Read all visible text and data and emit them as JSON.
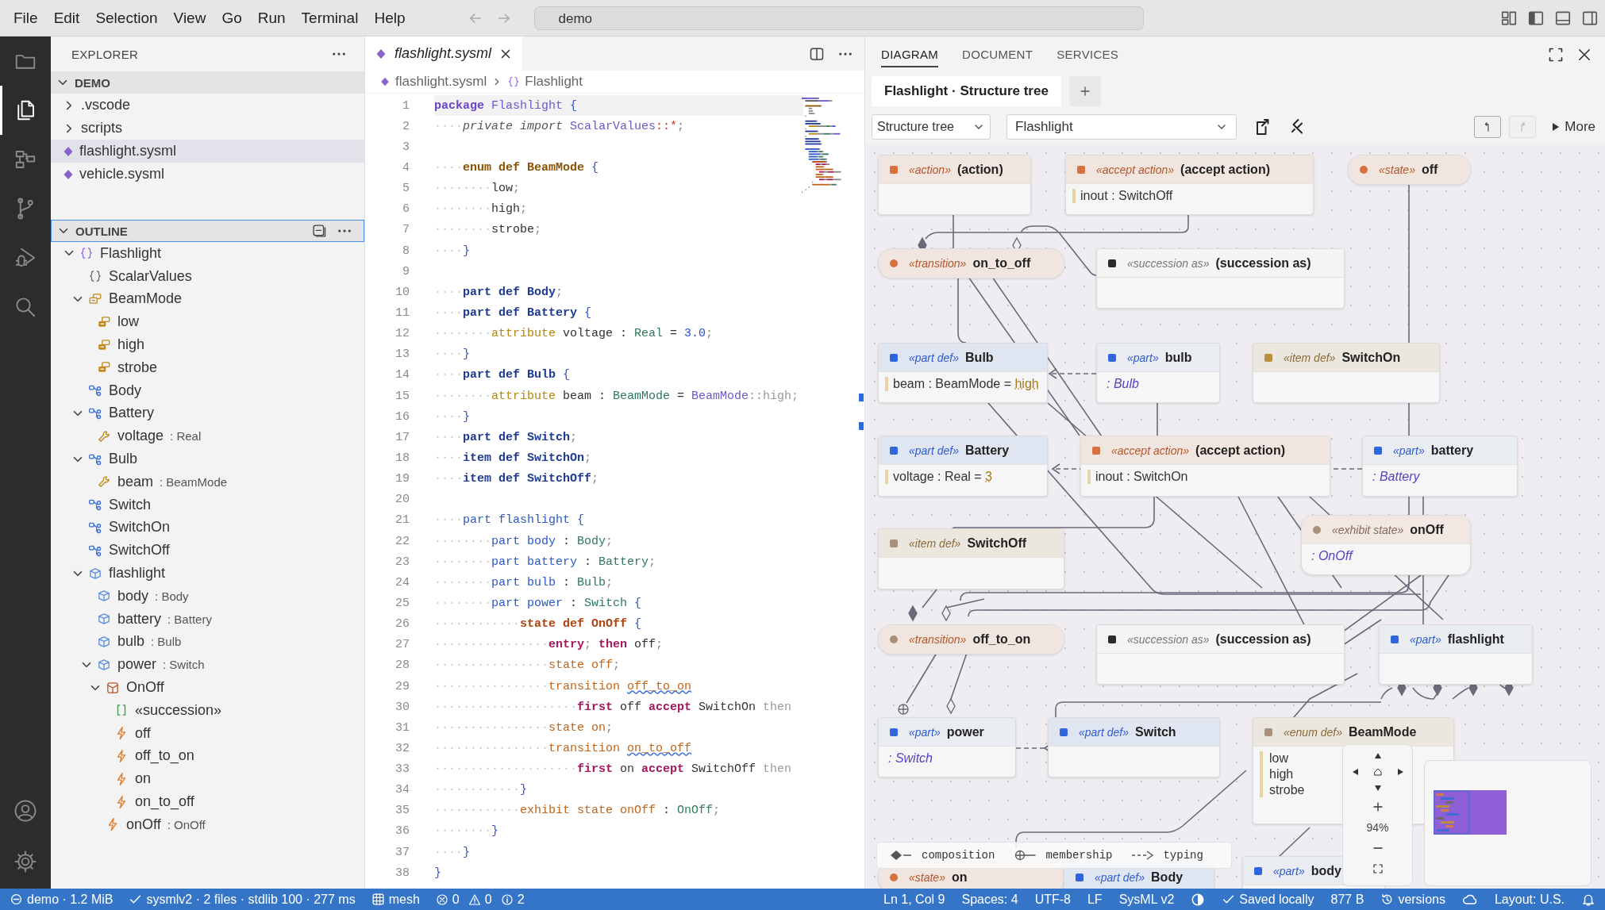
{
  "menu": [
    "File",
    "Edit",
    "Selection",
    "View",
    "Go",
    "Run",
    "Terminal",
    "Help"
  ],
  "command_center": {
    "value": "demo"
  },
  "activity_bar": [
    {
      "selected": false
    },
    {
      "selected": true
    },
    {
      "selected": false
    },
    {
      "selected": false
    },
    {
      "selected": false
    },
    {
      "selected": false
    },
    {
      "selected": false
    },
    {
      "selected": false
    }
  ],
  "sidebar": {
    "title": "EXPLORER",
    "explorer": {
      "title": "DEMO",
      "expanded": true,
      "items": [
        {
          "kind": "folder",
          "label": ".vscode",
          "expanded": false,
          "selected": false
        },
        {
          "kind": "folder",
          "label": "scripts",
          "expanded": false,
          "selected": false
        },
        {
          "kind": "file",
          "label": "flashlight.sysml",
          "selected": true
        },
        {
          "kind": "file",
          "label": "vehicle.sysml",
          "selected": false
        }
      ]
    },
    "outline": {
      "title": "OUTLINE",
      "expanded": true,
      "focused": true,
      "items": [
        {
          "kind": "package",
          "label": "Flashlight",
          "expanded": true,
          "children": [
            {
              "kind": "import",
              "label": "ScalarValues"
            },
            {
              "kind": "enum",
              "label": "BeamMode",
              "expanded": true,
              "children": [
                {
                  "kind": "literal",
                  "label": "low"
                },
                {
                  "kind": "literal",
                  "label": "high"
                },
                {
                  "kind": "literal",
                  "label": "strobe"
                }
              ]
            },
            {
              "kind": "part_def",
              "label": "Body"
            },
            {
              "kind": "part_def",
              "label": "Battery",
              "expanded": true,
              "children": [
                {
                  "kind": "attribute",
                  "label": "voltage",
                  "detail": ": Real"
                }
              ]
            },
            {
              "kind": "part_def",
              "label": "Bulb",
              "expanded": true,
              "children": [
                {
                  "kind": "attribute",
                  "label": "beam",
                  "detail": ": BeamMode"
                }
              ]
            },
            {
              "kind": "part_def",
              "label": "Switch"
            },
            {
              "kind": "part_def",
              "label": "SwitchOn"
            },
            {
              "kind": "part_def",
              "label": "SwitchOff"
            },
            {
              "kind": "part",
              "label": "flashlight",
              "expanded": true,
              "children": [
                {
                  "kind": "part",
                  "label": "body",
                  "detail": ": Body"
                },
                {
                  "kind": "part",
                  "label": "battery",
                  "detail": ": Battery"
                },
                {
                  "kind": "part",
                  "label": "bulb",
                  "detail": ": Bulb"
                },
                {
                  "kind": "part",
                  "label": "power",
                  "detail": ": Switch",
                  "expanded": true,
                  "children": [
                    {
                      "kind": "state_def",
                      "label": "OnOff",
                      "expanded": true,
                      "children": [
                        {
                          "kind": "succession",
                          "label": "«succession»"
                        },
                        {
                          "kind": "state",
                          "label": "off"
                        },
                        {
                          "kind": "state",
                          "label": "off_to_on"
                        },
                        {
                          "kind": "state",
                          "label": "on"
                        },
                        {
                          "kind": "state",
                          "label": "on_to_off"
                        }
                      ]
                    },
                    {
                      "kind": "state",
                      "label": "onOff",
                      "detail": ": OnOff"
                    }
                  ]
                }
              ]
            }
          ]
        }
      ]
    }
  },
  "editor": {
    "tab": {
      "label": "flashlight.sysml",
      "selected": true,
      "preview": true
    },
    "breadcrumb": [
      "flashlight.sysml",
      "Flashlight"
    ],
    "lines": [
      {
        "number": "1",
        "current": true,
        "tokens": [
          {
            "text": "package",
            "kind": "pk"
          },
          {
            "text": " Flashlight ",
            "kind": "id"
          },
          {
            "text": "{",
            "kind": "br"
          }
        ]
      },
      {
        "number": "2",
        "current": false,
        "tokens": [
          {
            "text": "····",
            "kind": "ws"
          },
          {
            "text": "private import ",
            "kind": "it"
          },
          {
            "text": "ScalarValues",
            "kind": "id"
          },
          {
            "text": "::*",
            "kind": "op"
          },
          {
            "text": ";",
            "kind": "pu"
          }
        ]
      },
      {
        "number": "3",
        "current": false
      },
      {
        "number": "4",
        "current": false,
        "tokens": [
          {
            "text": "····",
            "kind": "ws"
          },
          {
            "text": "enum def BeamMode ",
            "kind": "ke"
          },
          {
            "text": "{",
            "kind": "br"
          }
        ]
      },
      {
        "number": "5",
        "current": false,
        "tokens": [
          {
            "text": "········",
            "kind": "ws"
          },
          {
            "text": "low",
            "kind": "pl"
          },
          {
            "text": ";",
            "kind": "pu"
          }
        ]
      },
      {
        "number": "6",
        "current": false,
        "tokens": [
          {
            "text": "········",
            "kind": "ws"
          },
          {
            "text": "high",
            "kind": "pl"
          },
          {
            "text": ";",
            "kind": "pu"
          }
        ]
      },
      {
        "number": "7",
        "current": false,
        "tokens": [
          {
            "text": "········",
            "kind": "ws"
          },
          {
            "text": "strobe",
            "kind": "pl"
          },
          {
            "text": ";",
            "kind": "pu"
          }
        ]
      },
      {
        "number": "8",
        "current": false,
        "tokens": [
          {
            "text": "····",
            "kind": "ws"
          },
          {
            "text": "}",
            "kind": "br"
          }
        ]
      },
      {
        "number": "9",
        "current": false
      },
      {
        "number": "10",
        "current": false,
        "tokens": [
          {
            "text": "····",
            "kind": "ws"
          },
          {
            "text": "part def Body",
            "kind": "kd"
          },
          {
            "text": ";",
            "kind": "pu"
          }
        ]
      },
      {
        "number": "11",
        "current": false,
        "tokens": [
          {
            "text": "····",
            "kind": "ws"
          },
          {
            "text": "part def Battery ",
            "kind": "kd"
          },
          {
            "text": "{",
            "kind": "br"
          }
        ]
      },
      {
        "number": "12",
        "current": false,
        "tokens": [
          {
            "text": "········",
            "kind": "ws"
          },
          {
            "text": "attribute ",
            "kind": "at"
          },
          {
            "text": "voltage : ",
            "kind": "pl"
          },
          {
            "text": "Real",
            "kind": "ty"
          },
          {
            "text": " = ",
            "kind": "pl"
          },
          {
            "text": "3.0",
            "kind": "nu"
          },
          {
            "text": ";",
            "kind": "pu"
          }
        ]
      },
      {
        "number": "13",
        "current": false,
        "tokens": [
          {
            "text": "····",
            "kind": "ws"
          },
          {
            "text": "}",
            "kind": "br"
          }
        ]
      },
      {
        "number": "14",
        "current": false,
        "tokens": [
          {
            "text": "····",
            "kind": "ws"
          },
          {
            "text": "part def Bulb ",
            "kind": "kd"
          },
          {
            "text": "{",
            "kind": "br"
          }
        ]
      },
      {
        "number": "15",
        "current": false,
        "tokens": [
          {
            "text": "········",
            "kind": "ws"
          },
          {
            "text": "attribute ",
            "kind": "at"
          },
          {
            "text": "beam : ",
            "kind": "pl"
          },
          {
            "text": "BeamMode",
            "kind": "ty"
          },
          {
            "text": " = ",
            "kind": "pl"
          },
          {
            "text": "BeamMode",
            "kind": "id"
          },
          {
            "text": "::high;",
            "kind": "gh"
          }
        ]
      },
      {
        "number": "16",
        "current": false,
        "tokens": [
          {
            "text": "····",
            "kind": "ws"
          },
          {
            "text": "}",
            "kind": "br"
          }
        ]
      },
      {
        "number": "17",
        "current": false,
        "tokens": [
          {
            "text": "····",
            "kind": "ws"
          },
          {
            "text": "part def Switch",
            "kind": "kd"
          },
          {
            "text": ";",
            "kind": "pu"
          }
        ]
      },
      {
        "number": "18",
        "current": false,
        "tokens": [
          {
            "text": "····",
            "kind": "ws"
          },
          {
            "text": "item def SwitchOn",
            "kind": "kd"
          },
          {
            "text": ";",
            "kind": "pu"
          }
        ]
      },
      {
        "number": "19",
        "current": false,
        "tokens": [
          {
            "text": "····",
            "kind": "ws"
          },
          {
            "text": "item def SwitchOff",
            "kind": "kd"
          },
          {
            "text": ";",
            "kind": "pu"
          }
        ]
      },
      {
        "number": "20",
        "current": false
      },
      {
        "number": "21",
        "current": false,
        "tokens": [
          {
            "text": "····",
            "kind": "ws"
          },
          {
            "text": "part flashlight ",
            "kind": "pb"
          },
          {
            "text": "{",
            "kind": "br"
          }
        ]
      },
      {
        "number": "22",
        "current": false,
        "tokens": [
          {
            "text": "········",
            "kind": "ws"
          },
          {
            "text": "part body ",
            "kind": "pb"
          },
          {
            "text": ": ",
            "kind": "pl"
          },
          {
            "text": "Body",
            "kind": "ty"
          },
          {
            "text": ";",
            "kind": "pu"
          }
        ]
      },
      {
        "number": "23",
        "current": false,
        "tokens": [
          {
            "text": "········",
            "kind": "ws"
          },
          {
            "text": "part battery ",
            "kind": "pb"
          },
          {
            "text": ": ",
            "kind": "pl"
          },
          {
            "text": "Battery",
            "kind": "ty"
          },
          {
            "text": ";",
            "kind": "pu"
          }
        ]
      },
      {
        "number": "24",
        "current": false,
        "tokens": [
          {
            "text": "········",
            "kind": "ws"
          },
          {
            "text": "part bulb ",
            "kind": "pb"
          },
          {
            "text": ": ",
            "kind": "pl"
          },
          {
            "text": "Bulb",
            "kind": "ty"
          },
          {
            "text": ";",
            "kind": "pu"
          }
        ]
      },
      {
        "number": "25",
        "current": false,
        "tokens": [
          {
            "text": "········",
            "kind": "ws"
          },
          {
            "text": "part power ",
            "kind": "pb"
          },
          {
            "text": ": ",
            "kind": "pl"
          },
          {
            "text": "Switch ",
            "kind": "ty"
          },
          {
            "text": "{",
            "kind": "br"
          }
        ]
      },
      {
        "number": "26",
        "current": false,
        "tokens": [
          {
            "text": "············",
            "kind": "ws"
          },
          {
            "text": "state def OnOff ",
            "kind": "sd"
          },
          {
            "text": "{",
            "kind": "br"
          }
        ]
      },
      {
        "number": "27",
        "current": false,
        "tokens": [
          {
            "text": "················",
            "kind": "ws"
          },
          {
            "text": "entry",
            "kind": "km"
          },
          {
            "text": "; ",
            "kind": "pu"
          },
          {
            "text": "then ",
            "kind": "km"
          },
          {
            "text": "off",
            "kind": "pl"
          },
          {
            "text": ";",
            "kind": "pu"
          }
        ]
      },
      {
        "number": "28",
        "current": false,
        "tokens": [
          {
            "text": "················",
            "kind": "ws"
          },
          {
            "text": "state off",
            "kind": "st"
          },
          {
            "text": ";",
            "kind": "pu"
          }
        ]
      },
      {
        "number": "29",
        "current": false,
        "tokens": [
          {
            "text": "················",
            "kind": "ws"
          },
          {
            "text": "transition ",
            "kind": "st"
          },
          {
            "text": "off_to_on",
            "kind": "sq"
          }
        ]
      },
      {
        "number": "30",
        "current": false,
        "tokens": [
          {
            "text": "····················",
            "kind": "ws"
          },
          {
            "text": "first ",
            "kind": "km"
          },
          {
            "text": "off ",
            "kind": "pl"
          },
          {
            "text": "accept ",
            "kind": "km"
          },
          {
            "text": "SwitchOn",
            "kind": "pl"
          },
          {
            "text": " then",
            "kind": "gh"
          }
        ]
      },
      {
        "number": "31",
        "current": false,
        "tokens": [
          {
            "text": "················",
            "kind": "ws"
          },
          {
            "text": "state on",
            "kind": "st"
          },
          {
            "text": ";",
            "kind": "pu"
          }
        ]
      },
      {
        "number": "32",
        "current": false,
        "tokens": [
          {
            "text": "················",
            "kind": "ws"
          },
          {
            "text": "transition ",
            "kind": "st"
          },
          {
            "text": "on_to_off",
            "kind": "sq"
          }
        ]
      },
      {
        "number": "33",
        "current": false,
        "tokens": [
          {
            "text": "····················",
            "kind": "ws"
          },
          {
            "text": "first ",
            "kind": "km"
          },
          {
            "text": "on ",
            "kind": "pl"
          },
          {
            "text": "accept ",
            "kind": "km"
          },
          {
            "text": "SwitchOff",
            "kind": "pl"
          },
          {
            "text": " then",
            "kind": "gh"
          }
        ]
      },
      {
        "number": "34",
        "current": false,
        "tokens": [
          {
            "text": "············",
            "kind": "ws"
          },
          {
            "text": "}",
            "kind": "br"
          }
        ]
      },
      {
        "number": "35",
        "current": false,
        "tokens": [
          {
            "text": "············",
            "kind": "ws"
          },
          {
            "text": "exhibit state onOff ",
            "kind": "st"
          },
          {
            "text": ": ",
            "kind": "pl"
          },
          {
            "text": "OnOff",
            "kind": "ty"
          },
          {
            "text": ";",
            "kind": "pu"
          }
        ]
      },
      {
        "number": "36",
        "current": false,
        "tokens": [
          {
            "text": "········",
            "kind": "ws"
          },
          {
            "text": "}",
            "kind": "br"
          }
        ]
      },
      {
        "number": "37",
        "current": false,
        "tokens": [
          {
            "text": "····",
            "kind": "ws"
          },
          {
            "text": "}",
            "kind": "br"
          }
        ]
      },
      {
        "number": "38",
        "current": false,
        "tokens": [
          {
            "text": "}",
            "kind": "br"
          }
        ]
      }
    ]
  },
  "panel": {
    "tabs": [
      {
        "label": "DIAGRAM",
        "selected": true
      },
      {
        "label": "DOCUMENT",
        "selected": false
      },
      {
        "label": "SERVICES",
        "selected": false
      }
    ],
    "diagram_tabs": [
      {
        "label": "Flashlight · Structure tree",
        "selected": true
      }
    ],
    "toolbar": {
      "view_select": {
        "value": "Structure tree"
      },
      "root_select": {
        "value": "Flashlight"
      },
      "nav_buttons": [
        {
          "disabled": false
        },
        {
          "disabled": true
        }
      ],
      "more": "More"
    },
    "diagram": {
      "nodes": [
        {
          "kind": "action",
          "stereotype": "«action»",
          "name": "(action)",
          "color": "#d9703f"
        },
        {
          "kind": "action",
          "stereotype": "«accept action»",
          "name": "(accept action)",
          "color": "#d9703f",
          "rows": [
            {
              "kind": "feature",
              "text": "inout : SwitchOff"
            }
          ]
        },
        {
          "kind": "state",
          "stereotype": "«state»",
          "name": "off",
          "color": "#d9703f"
        },
        {
          "kind": "state",
          "stereotype": "«transition»",
          "name": "on_to_off",
          "color": "#d9703f"
        },
        {
          "kind": "succession",
          "stereotype": "«succession as»",
          "name": "(succession as)",
          "color": "#2b2b2b"
        },
        {
          "kind": "part_def",
          "stereotype": "«part def»",
          "name": "Bulb",
          "color": "#2f66dd",
          "rows": [
            {
              "kind": "feature",
              "text": "beam : BeamMode = ",
              "value": "high"
            }
          ]
        },
        {
          "kind": "part",
          "stereotype": "«part»",
          "name": "bulb",
          "color": "#2f66dd",
          "rows": [
            {
              "kind": "typing",
              "text": ": Bulb"
            }
          ]
        },
        {
          "kind": "item_def",
          "stereotype": "«item def»",
          "name": "SwitchOn",
          "color": "#b8903e"
        },
        {
          "kind": "part_def",
          "stereotype": "«part def»",
          "name": "Battery",
          "color": "#2f66dd",
          "rows": [
            {
              "kind": "feature",
              "text": "voltage : Real = ",
              "value": "3"
            }
          ]
        },
        {
          "kind": "action",
          "stereotype": "«accept action»",
          "name": "(accept action)",
          "color": "#d9703f",
          "rows": [
            {
              "kind": "feature",
              "text": "inout : SwitchOn"
            }
          ]
        },
        {
          "kind": "part",
          "stereotype": "«part»",
          "name": "battery",
          "color": "#2f66dd",
          "rows": [
            {
              "kind": "typing",
              "text": ": Battery"
            }
          ]
        },
        {
          "kind": "item_def",
          "stereotype": "«item def»",
          "name": "SwitchOff",
          "color": "#a8907a"
        },
        {
          "kind": "exhibit",
          "stereotype": "«exhibit state»",
          "name": "onOff",
          "color": "#a8907a",
          "rows": [
            {
              "kind": "typing",
              "text": ": OnOff"
            }
          ]
        },
        {
          "kind": "state",
          "stereotype": "«transition»",
          "name": "off_to_on",
          "color": "#a8907a"
        },
        {
          "kind": "succession",
          "stereotype": "«succession as»",
          "name": "(succession as)",
          "color": "#2b2b2b"
        },
        {
          "kind": "part",
          "stereotype": "«part»",
          "name": "flashlight",
          "color": "#2f66dd"
        },
        {
          "kind": "part",
          "stereotype": "«part»",
          "name": "power",
          "color": "#2f66dd",
          "rows": [
            {
              "kind": "typing",
              "text": ": Switch"
            }
          ]
        },
        {
          "kind": "part_def",
          "stereotype": "«part def»",
          "name": "Switch",
          "color": "#2f66dd"
        },
        {
          "kind": "enum_def",
          "stereotype": "«enum def»",
          "name": "BeamMode",
          "color": "#a8907a",
          "rows": [
            {
              "kind": "literals",
              "items": [
                "low",
                "high",
                "strobe"
              ]
            }
          ]
        },
        {
          "kind": "state",
          "stereotype": "«state»",
          "name": "on",
          "color": "#d9703f"
        },
        {
          "kind": "part_def",
          "stereotype": "«part def»",
          "name": "Body",
          "color": "#2f66dd"
        },
        {
          "kind": "part",
          "stereotype": "«part»",
          "name": "body",
          "color": "#2f66dd"
        }
      ],
      "legend": [
        "composition",
        "membership",
        "typing"
      ],
      "zoom": "94%"
    }
  },
  "status_bar": {
    "left": [
      "demo · 1.2 MiB",
      "sysmlv2 · 2 files · stdlib 100 · 277 ms",
      "mesh"
    ],
    "problems": {
      "errors": "0",
      "warnings": "0",
      "infos": "2"
    },
    "right": [
      "Ln 1, Col 9",
      "Spaces: 4",
      "UTF-8",
      "LF",
      "SysML v2",
      "Saved locally",
      "877 B",
      "versions",
      "Layout: U.S."
    ]
  }
}
